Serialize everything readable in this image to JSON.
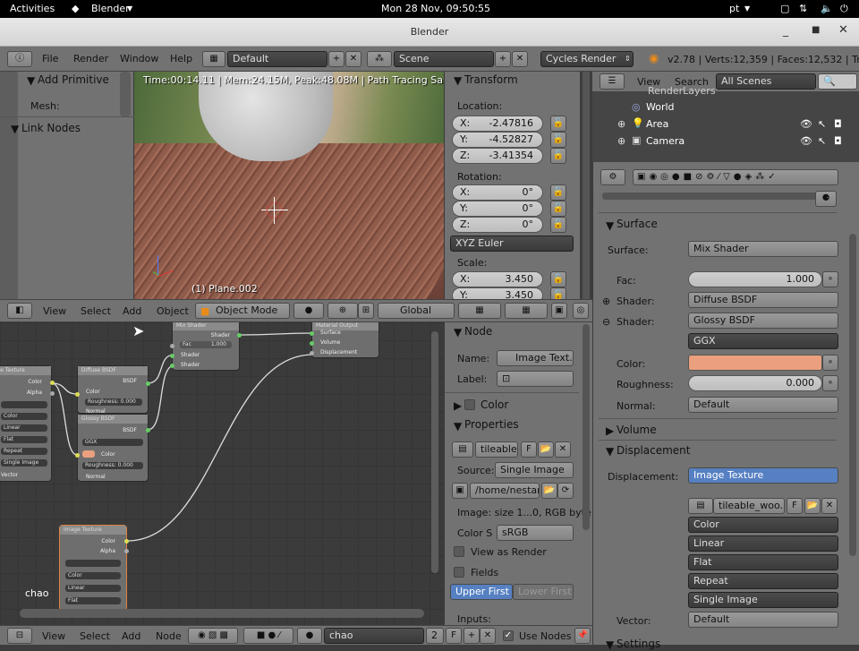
{
  "system": {
    "activities": "Activities",
    "app": "Blender",
    "datetime": "Mon 28 Nov, 09:50:55",
    "lang": "pt"
  },
  "window": {
    "title": "Blender"
  },
  "menubar": {
    "file": "File",
    "render": "Render",
    "window": "Window",
    "help": "Help",
    "layout": "Default",
    "scene": "Scene",
    "engine": "Cycles Render",
    "stats": "v2.78 | Verts:12,359 | Faces:12,532 | Tris:2"
  },
  "tools": {
    "add_primitive": "Add Primitive",
    "mesh": "Mesh:",
    "link_nodes": "Link Nodes"
  },
  "viewport": {
    "info": "Time:00:14.11 | Mem:24.15M, Peak:48.08M | Path Tracing Sample 54",
    "object_label": "(1) Plane.002",
    "view": "View",
    "select": "Select",
    "add": "Add",
    "object": "Object",
    "mode": "Object Mode",
    "orientation": "Global"
  },
  "transform": {
    "title": "Transform",
    "location": "Location:",
    "loc_x": "X:",
    "loc_x_val": "-2.47816",
    "loc_y": "Y:",
    "loc_y_val": "-4.52827",
    "loc_z": "Z:",
    "loc_z_val": "-3.41354",
    "rotation": "Rotation:",
    "rot_x": "X:",
    "rot_x_val": "0°",
    "rot_y": "Y:",
    "rot_y_val": "0°",
    "rot_z": "Z:",
    "rot_z_val": "0°",
    "euler": "XYZ Euler",
    "scale": "Scale:",
    "scl_x": "X:",
    "scl_x_val": "3.450",
    "scl_y": "Y:",
    "scl_y_val": "3.450"
  },
  "outliner": {
    "view": "View",
    "search": "Search",
    "scenes": "All Scenes",
    "renderlayers": "RenderLayers",
    "world": "World",
    "area": "Area",
    "camera": "Camera"
  },
  "properties": {
    "surface_title": "Surface",
    "surface_lbl": "Surface:",
    "surface_val": "Mix Shader",
    "fac_lbl": "Fac:",
    "fac_val": "1.000",
    "shader1_lbl": "Shader:",
    "shader1_val": "Diffuse BSDF",
    "shader2_lbl": "Shader:",
    "shader2_val": "Glossy BSDF",
    "ggx": "GGX",
    "color_lbl": "Color:",
    "color_val": "#eaa07e",
    "rough_lbl": "Roughness:",
    "rough_val": "0.000",
    "normal_lbl": "Normal:",
    "normal_val": "Default",
    "volume": "Volume",
    "displacement_title": "Displacement",
    "disp_lbl": "Displacement:",
    "disp_val": "Image Texture",
    "tex_name": "tileable_woo...",
    "tex_f": "F",
    "opt_color": "Color",
    "opt_linear": "Linear",
    "opt_flat": "Flat",
    "opt_repeat": "Repeat",
    "opt_single": "Single Image",
    "vector_lbl": "Vector:",
    "vector_val": "Default",
    "settings": "Settings"
  },
  "node_sidebar": {
    "node_title": "Node",
    "name_lbl": "Name:",
    "name_val": "Image Text...",
    "label_lbl": "Label:",
    "color_title": "Color",
    "props_title": "Properties",
    "img_name": "tileable_",
    "img_f": "F",
    "source_lbl": "Source:",
    "source_val": "Single Image",
    "path": "/home/nestan...",
    "img_info": "Image: size 1...0, RGB byte",
    "colorspace_lbl": "Color S",
    "colorspace_val": "sRGB",
    "view_render": "View as Render",
    "fields": "Fields",
    "upper_first": "Upper First",
    "lower_first": "Lower First",
    "inputs": "Inputs:"
  },
  "node_editor": {
    "view": "View",
    "select": "Select",
    "add": "Add",
    "node": "Node",
    "material": "chao",
    "users": "2",
    "fake": "F",
    "use_nodes": "Use Nodes",
    "mat_label": "chao"
  },
  "nodes": {
    "mix": {
      "title": "Mix Shader",
      "shader_out": "Shader",
      "fac": "Fac",
      "fac_val": "1.000",
      "s1": "Shader",
      "s2": "Shader"
    },
    "output": {
      "title": "Material Output",
      "surface": "Surface",
      "volume": "Volume",
      "disp": "Displacement"
    },
    "img1": {
      "title": "Image Texture",
      "color": "Color",
      "alpha": "Alpha",
      "o1": "Color",
      "o2": "Linear",
      "o3": "Flat",
      "o4": "Repeat",
      "o5": "Single Image",
      "vector": "Vector"
    },
    "diffuse": {
      "title": "Diffuse BSDF",
      "bsdf": "BSDF",
      "color": "Color",
      "rough": "Roughness: 0.000",
      "normal": "Normal"
    },
    "glossy": {
      "title": "Glossy BSDF",
      "bsdf": "BSDF",
      "ggx": "GGX",
      "color": "Color",
      "rough": "Roughness: 0.000",
      "normal": "Normal"
    },
    "img2": {
      "title": "Image Texture",
      "color": "Color",
      "alpha": "Alpha",
      "o1": "Color",
      "o2": "Linear",
      "o3": "Flat"
    }
  }
}
